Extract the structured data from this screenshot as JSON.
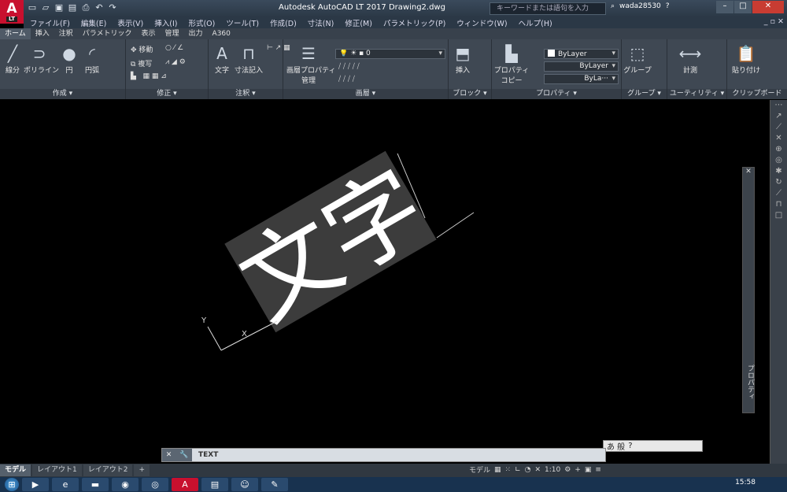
{
  "title_bar": {
    "app_title": "Autodesk AutoCAD LT 2017    Drawing2.dwg",
    "search_placeholder": "キーワードまたは語句を入力",
    "user": "wada28530"
  },
  "menu": [
    "ファイル(F)",
    "編集(E)",
    "表示(V)",
    "挿入(I)",
    "形式(O)",
    "ツール(T)",
    "作成(D)",
    "寸法(N)",
    "修正(M)",
    "パラメトリック(P)",
    "ウィンドウ(W)",
    "ヘルプ(H)"
  ],
  "ribbon_tabs": [
    "ホーム",
    "挿入",
    "注釈",
    "パラメトリック",
    "表示",
    "管理",
    "出力",
    "A360"
  ],
  "ribbon": {
    "draw": {
      "title": "作成 ▾",
      "line": "線分",
      "polyline": "ポリライン",
      "circle": "円",
      "arc": "円弧"
    },
    "modify": {
      "title": "修正 ▾",
      "move": "移動",
      "copy": "複写"
    },
    "annotation": {
      "title": "注釈 ▾",
      "text": "文字",
      "dimension": "寸法記入"
    },
    "layers": {
      "title": "画層 ▾",
      "layer_props": "画層プロパティ",
      "layer_props2": "管理",
      "current_layer": "0"
    },
    "block": {
      "title": "ブロック ▾",
      "insert": "挿入"
    },
    "properties": {
      "title": "プロパティ ▾",
      "match": "プロパティ",
      "match2": "コピー",
      "color": "ByLayer",
      "linetype": "ByLayer",
      "lineweight": "ByLa···"
    },
    "groups": {
      "title": "グループ ▾",
      "group": "グループ"
    },
    "utilities": {
      "title": "ユーティリティ ▾",
      "measure": "計測"
    },
    "clipboard": {
      "title": "クリップボード",
      "paste": "貼り付け"
    }
  },
  "drawing": {
    "text": "文字",
    "ucs_x": "X",
    "ucs_y": "Y"
  },
  "palette": {
    "label": "プロパティ"
  },
  "command_line": {
    "prompt": "TEXT"
  },
  "ime": {
    "text": "あ 般"
  },
  "layout_tabs": [
    "モデル",
    "レイアウト1",
    "レイアウト2",
    "+"
  ],
  "status": {
    "model": "モデル",
    "scale": "1:10"
  },
  "clock": "15:58",
  "colors": {
    "accent": "#c8102e",
    "ribbon": "#3f4853",
    "canvas": "#000000",
    "text_bg": "#3c3c3c"
  }
}
